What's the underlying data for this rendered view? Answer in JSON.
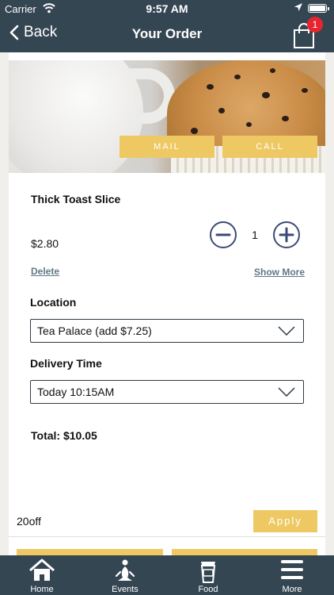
{
  "status_bar": {
    "carrier": "Carrier",
    "time": "9:57 AM"
  },
  "nav": {
    "back_label": "Back",
    "title": "Your Order",
    "cart_count": "1"
  },
  "hero": {
    "mail_label": "MAIL",
    "call_label": "CALL"
  },
  "item": {
    "name": "Thick Toast Slice",
    "price": "$2.80",
    "quantity": "1",
    "delete_label": "Delete",
    "show_more_label": "Show More"
  },
  "location": {
    "label": "Location",
    "selected": "Tea Palace (add $7.25)"
  },
  "delivery": {
    "label": "Delivery Time",
    "selected": "Today 10:15AM"
  },
  "total": "Total: $10.05",
  "coupon": {
    "value": "20off",
    "apply_label": "Apply"
  },
  "tabs": [
    {
      "label": "Home",
      "icon": "home-icon"
    },
    {
      "label": "Events",
      "icon": "meditation-icon"
    },
    {
      "label": "Food",
      "icon": "coffee-cup-icon"
    },
    {
      "label": "More",
      "icon": "menu-icon"
    }
  ],
  "colors": {
    "header_bg": "#354653",
    "accent_gold": "#eec963",
    "badge_red": "#e8242f",
    "stepper_blue": "#3c4a78",
    "link_teal": "#5e7983"
  }
}
